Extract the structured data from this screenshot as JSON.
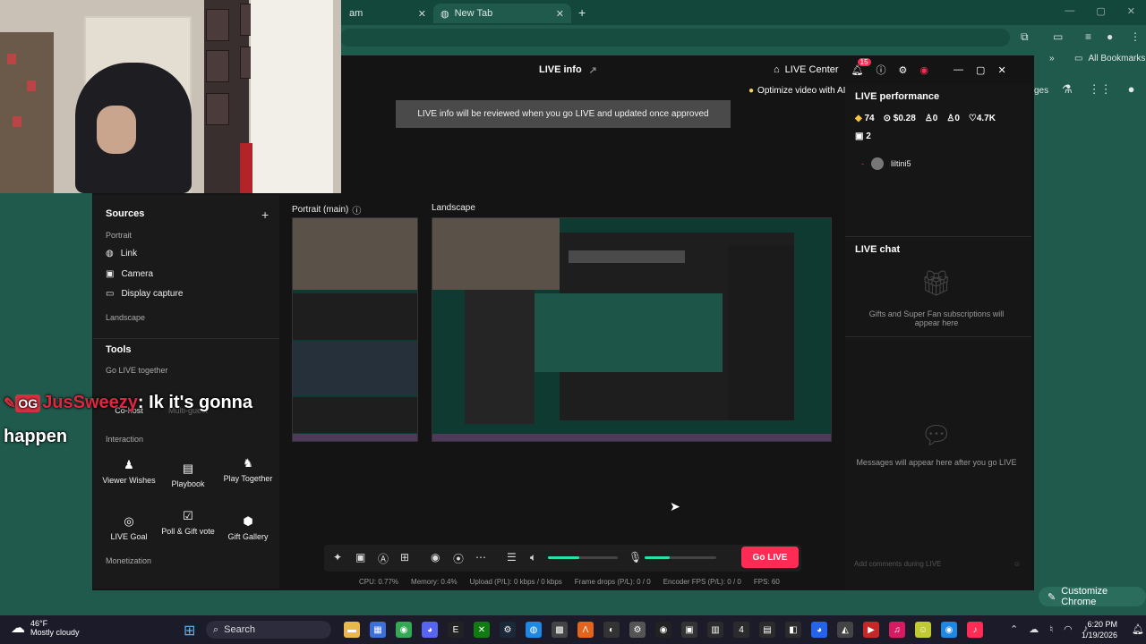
{
  "browser": {
    "tabs": [
      {
        "label": "am"
      },
      {
        "label": "New Tab"
      }
    ],
    "bookmarks_label": "All Bookmarks",
    "right_partial_label": "ges",
    "customize_label": "Customize Chrome"
  },
  "app": {
    "title": "LIVE info",
    "live_center_label": "LIVE Center",
    "notification_count": "15",
    "optimize_label": "Optimize video with AI",
    "review_banner": "LIVE info will be reviewed when you go LIVE and updated once approved"
  },
  "left_panel": {
    "sources_title": "Sources",
    "portrait_label": "Portrait",
    "portrait_sources": [
      "Link",
      "Camera",
      "Display capture"
    ],
    "landscape_label": "Landscape",
    "tools_title": "Tools",
    "go_live_together_label": "Go LIVE together",
    "cohost_label": "Co-host",
    "multiguest_label": "Multi-guest",
    "interaction_label": "Interaction",
    "interaction_tools": [
      {
        "label": "Viewer Wishes",
        "icon": "viewer-wishes-icon"
      },
      {
        "label": "Playbook",
        "icon": "playbook-icon"
      },
      {
        "label": "Play Together",
        "icon": "play-together-icon"
      },
      {
        "label": "LIVE Goal",
        "icon": "live-goal-icon"
      },
      {
        "label": "Poll & Gift vote",
        "icon": "poll-icon"
      },
      {
        "label": "Gift Gallery",
        "icon": "gift-gallery-icon"
      }
    ],
    "monetization_label": "Monetization"
  },
  "preview": {
    "portrait_label": "Portrait (main)",
    "landscape_label": "Landscape"
  },
  "controls": {
    "go_live_label": "Go LIVE",
    "volume_level": 0.45,
    "mic_level": 0.35
  },
  "stats": {
    "cpu": "CPU: 0.77%",
    "memory": "Memory: 0.4%",
    "upload": "Upload (P/L): 0 kbps / 0 kbps",
    "frame_drops": "Frame drops (P/L): 0 / 0",
    "encoder_fps": "Encoder FPS (P/L): 0 / 0",
    "fps": "FPS: 60"
  },
  "performance": {
    "title": "LIVE performance",
    "diamonds": "74",
    "earnings": "$0.28",
    "viewers": "0",
    "followers": "0",
    "likes": "4.7K",
    "gifts": "2",
    "viewer_name": "liltini5"
  },
  "chat": {
    "title": "LIVE chat",
    "gifts_empty": "Gifts and Super Fan subscriptions will appear here",
    "messages_empty": "Messages will appear here after you go LIVE",
    "input_placeholder": "Add comments during LIVE"
  },
  "caption": {
    "badge": "OG",
    "username": "JusSweezy",
    "message": "Ik it's gonna happen"
  },
  "taskbar": {
    "temperature": "46°F",
    "weather": "Mostly cloudy",
    "search_label": "Search",
    "time": "6:20 PM",
    "date": "1/19/2026"
  },
  "colors": {
    "chrome_bg": "#1f5a4c",
    "app_bg": "#141414",
    "accent_pink": "#fe2c55",
    "accent_teal": "#2be0a8"
  }
}
